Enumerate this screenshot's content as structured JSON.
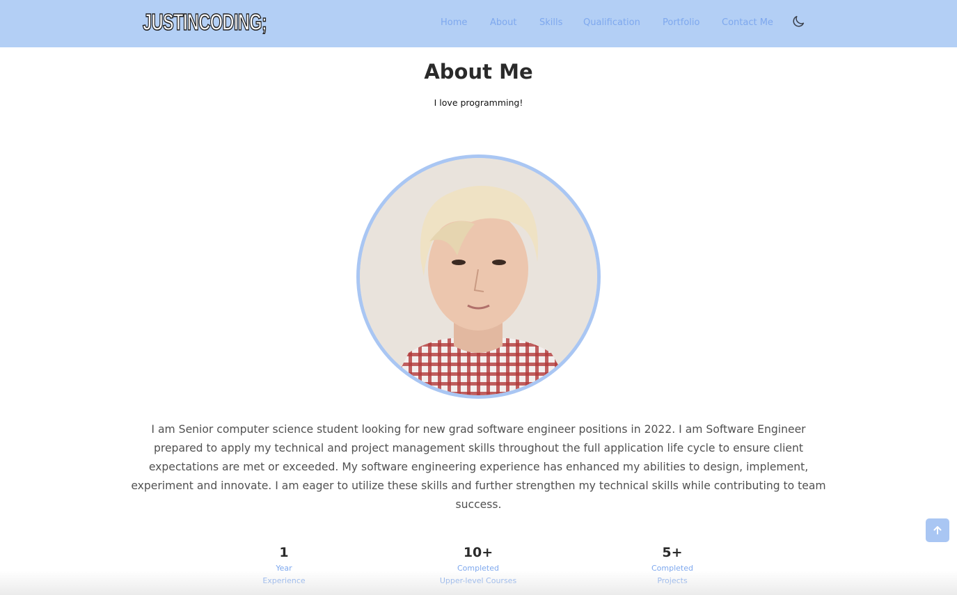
{
  "header": {
    "logo_text": "JUSTINCODING;",
    "nav": [
      {
        "label": "Home"
      },
      {
        "label": "About"
      },
      {
        "label": "Skills"
      },
      {
        "label": "Qualification"
      },
      {
        "label": "Portfolio"
      },
      {
        "label": "Contact Me"
      }
    ],
    "theme_icon": "moon-icon"
  },
  "about": {
    "title": "About Me",
    "subtitle": "I love programming!",
    "avatar_icon": "profile-photo",
    "description": "I am Senior computer science student looking for new grad software engineer positions in 2022. I am Software Engineer prepared to apply my technical and project management skills throughout the full application life cycle to ensure client expectations are met or exceeded. My software engineering experience has enhanced my abilities to design, implement, experiment and innovate. I am eager to utilize these skills and further strengthen my technical skills while contributing to team success.",
    "stats": [
      {
        "number": "1",
        "line1": "Year",
        "line2": "Experience"
      },
      {
        "number": "10+",
        "line1": "Completed",
        "line2": "Upper-level Courses"
      },
      {
        "number": "5+",
        "line1": "Completed",
        "line2": "Projects"
      }
    ]
  },
  "scroll_top_icon": "arrow-up-icon",
  "colors": {
    "header_bg": "#b3cff5",
    "accent": "#7ea8ee",
    "ring": "#a9c6f3"
  }
}
